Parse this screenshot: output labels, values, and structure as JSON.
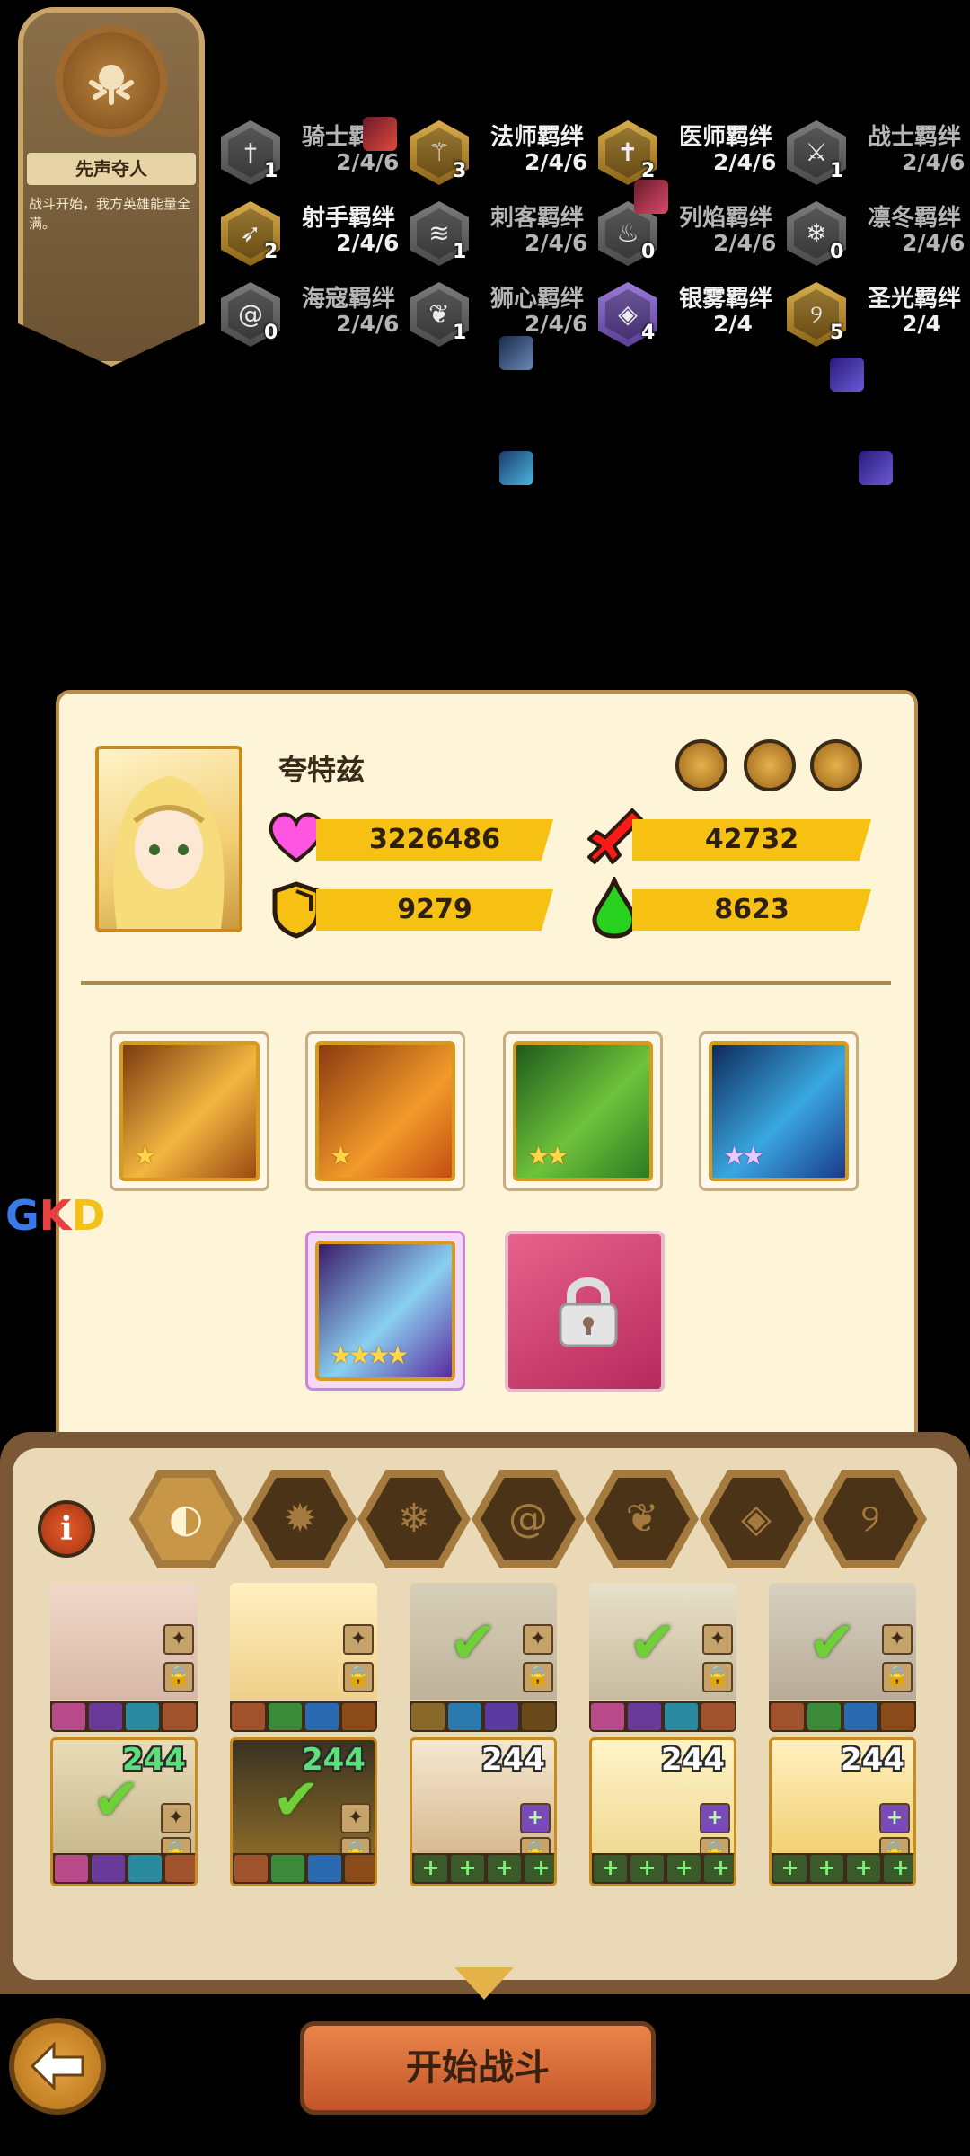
{
  "skill": {
    "title": "先声夺人",
    "desc": "战斗开始，我方英雄能量全满。"
  },
  "bonds": [
    {
      "name": "骑士羁绊",
      "tier": "2/4/6",
      "count": "1",
      "icon": "sword-icon",
      "style": "grey",
      "active": false
    },
    {
      "name": "法师羁绊",
      "tier": "2/4/6",
      "count": "3",
      "icon": "staff-icon",
      "style": "gold",
      "active": true
    },
    {
      "name": "医师羁绊",
      "tier": "2/4/6",
      "count": "2",
      "icon": "cross-icon",
      "style": "gold",
      "active": true
    },
    {
      "name": "战士羁绊",
      "tier": "2/4/6",
      "count": "1",
      "icon": "axe-icon",
      "style": "grey",
      "active": false
    },
    {
      "name": "射手羁绊",
      "tier": "2/4/6",
      "count": "2",
      "icon": "arrows-icon",
      "style": "gold",
      "active": true
    },
    {
      "name": "刺客羁绊",
      "tier": "2/4/6",
      "count": "1",
      "icon": "claw-icon",
      "style": "grey",
      "active": false
    },
    {
      "name": "列焰羁绊",
      "tier": "2/4/6",
      "count": "0",
      "icon": "flame-icon",
      "style": "grey",
      "active": false
    },
    {
      "name": "凛冬羁绊",
      "tier": "2/4/6",
      "count": "0",
      "icon": "snowflake-icon",
      "style": "grey",
      "active": false
    },
    {
      "name": "海寇羁绊",
      "tier": "2/4/6",
      "count": "0",
      "icon": "wave-icon",
      "style": "grey",
      "active": false
    },
    {
      "name": "狮心羁绊",
      "tier": "2/4/6",
      "count": "1",
      "icon": "leaf-icon",
      "style": "grey",
      "active": false
    },
    {
      "name": "银雾羁绊",
      "tier": "2/4",
      "count": "4",
      "icon": "eye-icon",
      "style": "purple",
      "active": true
    },
    {
      "name": "圣光羁绊",
      "tier": "2/4",
      "count": "5",
      "icon": "swirl-icon",
      "style": "gold",
      "active": true
    }
  ],
  "hero": {
    "name": "夸特兹",
    "hp": "3226486",
    "attack": "42732",
    "defense": "9279",
    "energy": "8623"
  },
  "equipment": [
    {
      "name": "weapon-slot",
      "stars": "★",
      "star_color": "gold",
      "gradient": "linear-gradient(135deg,#7a3a10,#f2b640 55%,#9a4a12)"
    },
    {
      "name": "cloak-slot",
      "stars": "★",
      "star_color": "gold",
      "gradient": "linear-gradient(135deg,#8a3a10,#f29a2a 60%,#c44d12)"
    },
    {
      "name": "armor-slot",
      "stars": "★★",
      "star_color": "gold",
      "gradient": "linear-gradient(135deg,#1d5a1d,#6fc23a 55%,#2e7a23)"
    },
    {
      "name": "boots-slot",
      "stars": "★★",
      "star_color": "purple",
      "gradient": "linear-gradient(135deg,#0e2a5a,#3aa7e0 55%,#1a3a8a)"
    },
    {
      "name": "artifact-slot",
      "stars": "★★★★",
      "star_color": "gold",
      "gradient": "linear-gradient(135deg,#3a1a6a,#8ad0f0 55%,#5a2aa0)"
    }
  ],
  "filters": [
    "all-faction-icon",
    "flame-faction-icon",
    "frost-faction-icon",
    "wave-faction-icon",
    "leaf-faction-icon",
    "eye-faction-icon",
    "holy-faction-icon"
  ],
  "filter_glyphs": [
    "◐",
    "✹",
    "❄",
    "@",
    "❦",
    "◈",
    "୨"
  ],
  "roster_row1": [
    {
      "gradient": "linear-gradient(#f0d8c8,#d8b8a8)",
      "check": false
    },
    {
      "gradient": "linear-gradient(#fff0c0,#f0d08a)",
      "check": false
    },
    {
      "gradient": "linear-gradient(#d8cfb8,#bfb39a)",
      "check": true
    },
    {
      "gradient": "linear-gradient(#e8e0c8,#c8bca0)",
      "check": true
    },
    {
      "gradient": "linear-gradient(#d8d0c0,#b8ac98)",
      "check": true
    }
  ],
  "roster_row2": [
    {
      "level": "244",
      "green": true,
      "check": true,
      "gradient": "linear-gradient(#e8dcb8,#c8b88c)"
    },
    {
      "level": "244",
      "green": true,
      "check": true,
      "gradient": "linear-gradient(#3a3220,#8a6a2a)"
    },
    {
      "level": "244",
      "green": false,
      "check": false,
      "gradient": "linear-gradient(#f4e8d0,#d8b890)"
    },
    {
      "level": "244",
      "green": false,
      "check": false,
      "gradient": "linear-gradient(#fff4c8,#f0d890)"
    },
    {
      "level": "244",
      "green": false,
      "check": false,
      "gradient": "linear-gradient(#fff0c0,#f2d070)"
    }
  ],
  "start_button": "开始战斗",
  "watermark": "GKD",
  "colors": {
    "bar": "#f7c113",
    "card_bg": "#fef4d8",
    "heart": "#ff55e0",
    "attack": "#ff1a1a",
    "energy": "#28d21e"
  }
}
